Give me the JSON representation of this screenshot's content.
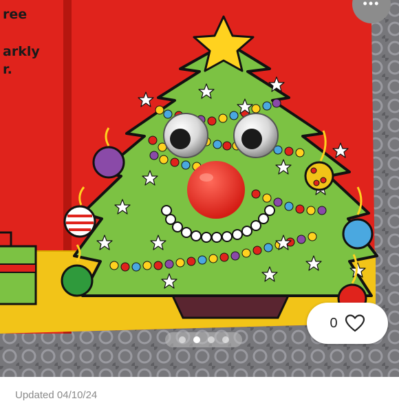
{
  "header": {
    "close_icon": "more-dots-icon",
    "close_glyph": "•••"
  },
  "book": {
    "line1": "ree",
    "line2": "arkly",
    "line3": "r."
  },
  "like": {
    "count": "0",
    "icon": "heart-outline-icon"
  },
  "carousel": {
    "total": 4,
    "active_index": 1
  },
  "footer": {
    "updated_text": "Updated 04/10/24"
  },
  "colors": {
    "page_red": "#e0231c",
    "tree_green": "#7cc243",
    "floor_yellow": "#f2c418",
    "star_yellow": "#ffd21f",
    "nose_red": "#e5221d"
  }
}
